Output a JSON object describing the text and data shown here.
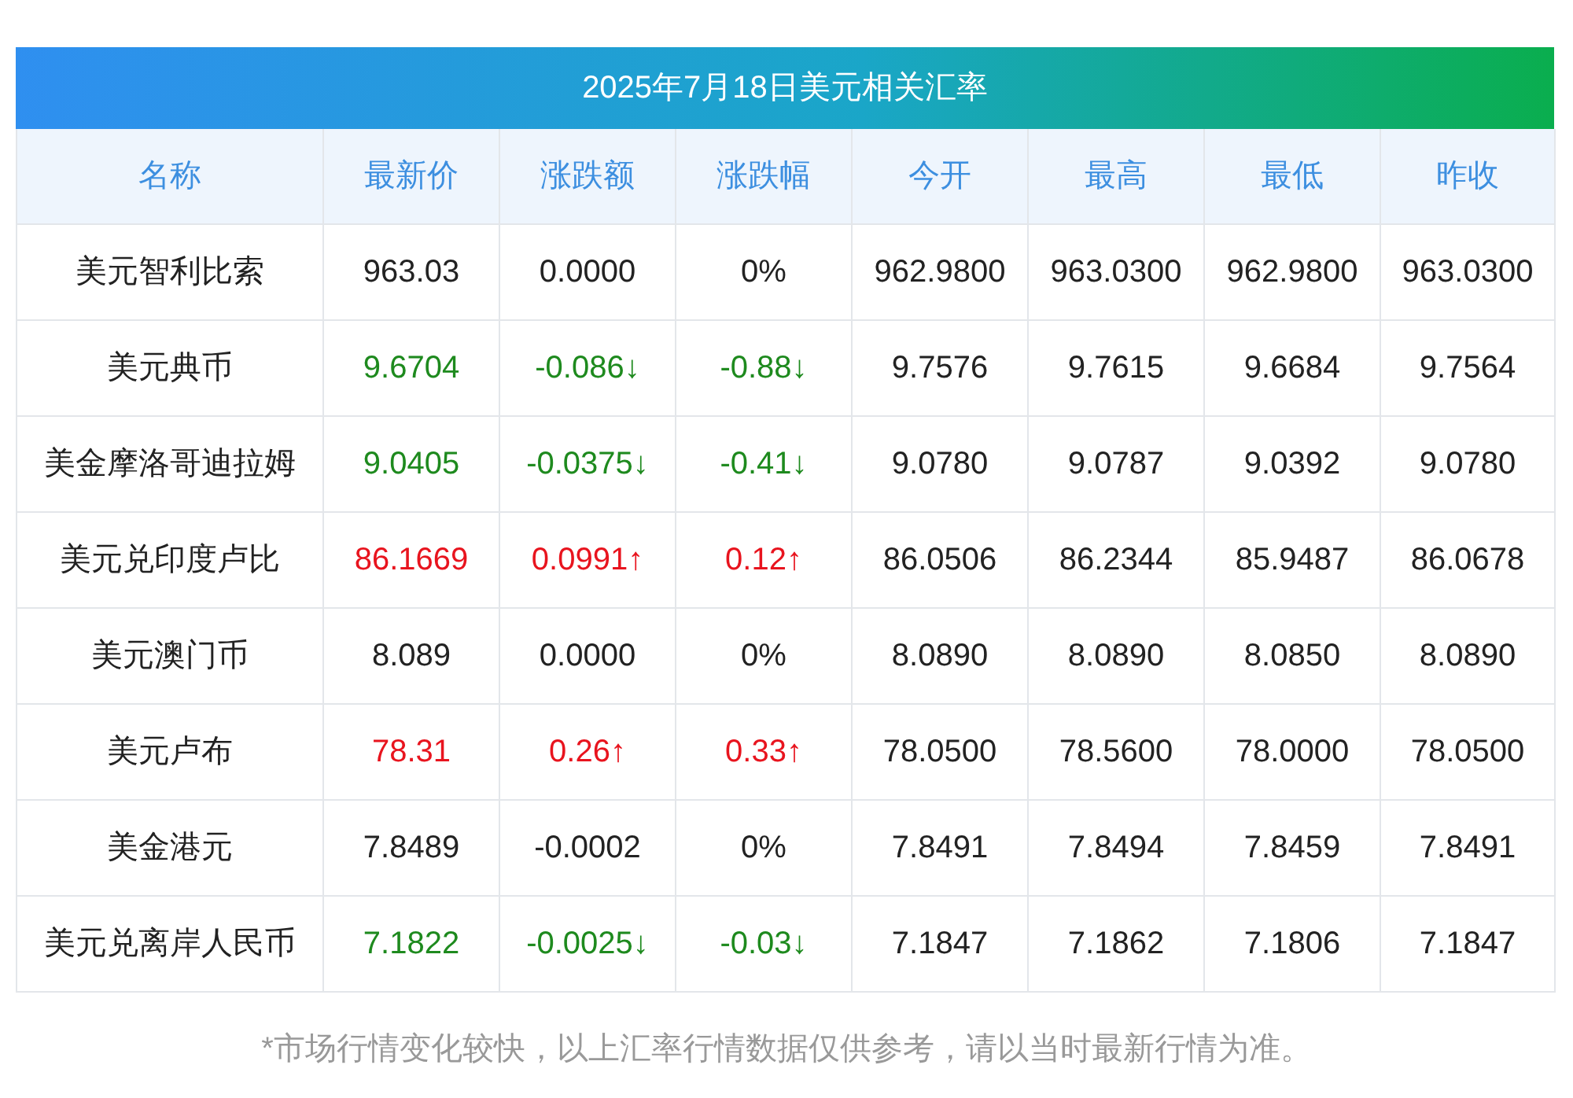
{
  "title": "2025年7月18日美元相关汇率",
  "columns": [
    "名称",
    "最新价",
    "涨跌额",
    "涨跌幅",
    "今开",
    "最高",
    "最低",
    "昨收"
  ],
  "rows": [
    {
      "color": "#222222",
      "cells": [
        "美元智利比索",
        "963.03",
        "0.0000",
        "0%",
        "962.9800",
        "963.0300",
        "962.9800",
        "963.0300"
      ]
    },
    {
      "color": "#1e8a1e",
      "cells": [
        "美元典币",
        "9.6704",
        "-0.086↓",
        "-0.88↓",
        "9.7576",
        "9.7615",
        "9.6684",
        "9.7564"
      ]
    },
    {
      "color": "#1e8a1e",
      "cells": [
        "美金摩洛哥迪拉姆",
        "9.0405",
        "-0.0375↓",
        "-0.41↓",
        "9.0780",
        "9.0787",
        "9.0392",
        "9.0780"
      ]
    },
    {
      "color": "#e8141e",
      "cells": [
        "美元兑印度卢比",
        "86.1669",
        "0.0991↑",
        "0.12↑",
        "86.0506",
        "86.2344",
        "85.9487",
        "86.0678"
      ]
    },
    {
      "color": "#222222",
      "cells": [
        "美元澳门币",
        "8.089",
        "0.0000",
        "0%",
        "8.0890",
        "8.0890",
        "8.0850",
        "8.0890"
      ]
    },
    {
      "color": "#e8141e",
      "cells": [
        "美元卢布",
        "78.31",
        "0.26↑",
        "0.33↑",
        "78.0500",
        "78.5600",
        "78.0000",
        "78.0500"
      ]
    },
    {
      "color": "#222222",
      "cells": [
        "美金港元",
        "7.8489",
        "-0.0002",
        "0%",
        "7.8491",
        "7.8494",
        "7.8459",
        "7.8491"
      ]
    },
    {
      "color": "#1e8a1e",
      "cells": [
        "美元兑离岸人民币",
        "7.1822",
        "-0.0025↓",
        "-0.03↓",
        "7.1847",
        "7.1862",
        "7.1806",
        "7.1847"
      ]
    }
  ],
  "footnote": "*市场行情变化较快，以上汇率行情数据仅供参考，请以当时最新行情为准。"
}
